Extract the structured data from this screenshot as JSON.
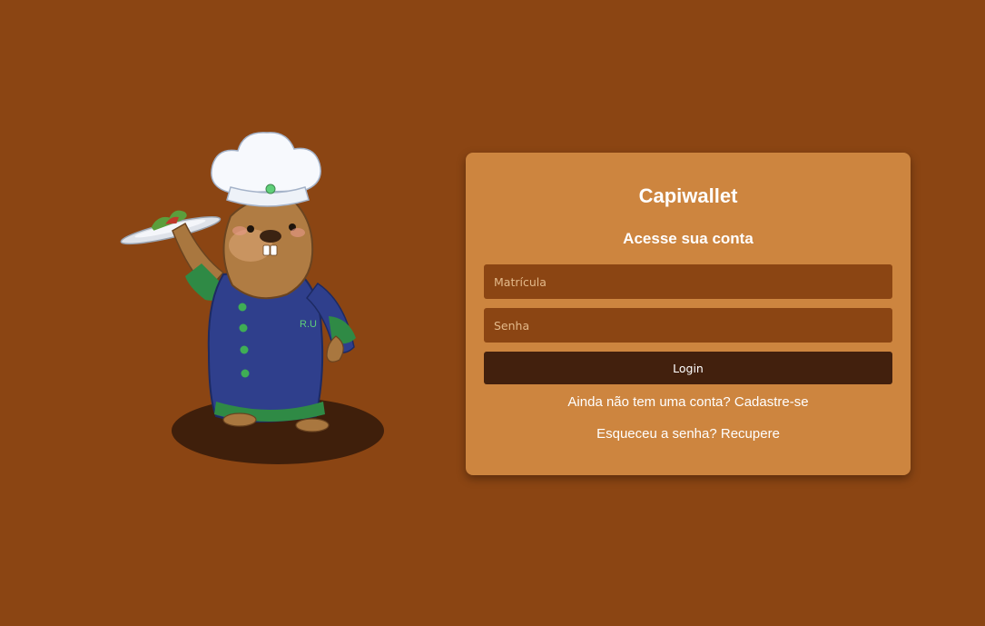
{
  "mascot": {
    "icon": "capybara-chef-illustration",
    "jacket_text": "R.U"
  },
  "login_card": {
    "title": "Capiwallet",
    "subtitle": "Acesse sua conta",
    "matricula_placeholder": "Matrícula",
    "matricula_value": "",
    "senha_placeholder": "Senha",
    "senha_value": "",
    "login_label": "Login",
    "signup_link": "Ainda não tem uma conta? Cadastre-se",
    "recover_link": "Esqueceu a senha? Recupere"
  },
  "colors": {
    "background": "#8b4513",
    "card": "#cd853f",
    "input": "#8b4513",
    "button": "#42200d",
    "text": "#ffffff"
  }
}
